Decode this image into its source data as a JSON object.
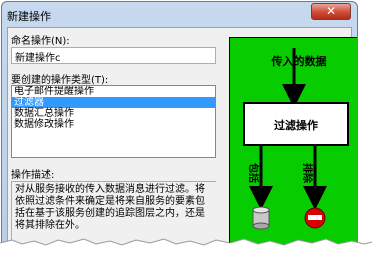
{
  "window": {
    "title": "新建操作",
    "close_glyph": "✕"
  },
  "name_field": {
    "label": "命名操作(N):",
    "value": "新建操作c"
  },
  "type_list": {
    "label": "要创建的操作类型(T):",
    "items": [
      "电子邮件提醒操作",
      "过滤器",
      "数据汇总操作",
      "数据修改操作"
    ],
    "selected_index": 1
  },
  "description": {
    "label": "操作描述:",
    "text": "对从服务接收的传入数据消息进行过滤。将依照过滤条件来确定是将来自服务的要素包括在基于该服务创建的追踪图层之内，还是将其排除在外。"
  },
  "diagram": {
    "background": "#06cc00",
    "incoming_label": "传入的数据",
    "box_label": "过滤操作",
    "include_label": "包括",
    "exclude_label": "排除",
    "include_icon": "database-icon",
    "exclude_icon": "no-entry-icon"
  }
}
